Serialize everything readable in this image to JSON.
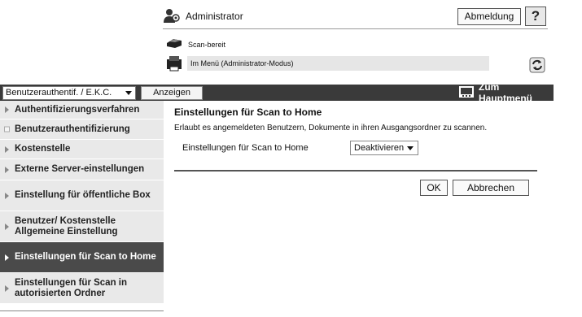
{
  "header": {
    "user_label": "Administrator",
    "logout_label": "Abmeldung",
    "help_label": "?",
    "status_ready": "Scan-bereit",
    "status_menu": "Im Menü (Administrator-Modus)"
  },
  "toolbar": {
    "mode_select_value": "Benutzerauthentif. / E.K.C.",
    "show_label": "Anzeigen",
    "home_label": "Zum Hauptmenü"
  },
  "sidebar": {
    "items": [
      {
        "label": "Authentifizierungsverfahren",
        "marker": "arrow",
        "active": false
      },
      {
        "label": "Benutzerauthentifizierung",
        "marker": "square",
        "active": false
      },
      {
        "label": "Kostenstelle",
        "marker": "arrow",
        "active": false
      },
      {
        "label": "Externe Server-einstellungen",
        "marker": "arrow",
        "active": false
      },
      {
        "label": "Einstellung für öffentliche Box",
        "marker": "arrow",
        "active": false
      },
      {
        "label": "Benutzer/ Kostenstelle Allgemeine Einstellung",
        "marker": "arrow",
        "active": false
      },
      {
        "label": "Einstellungen für Scan to Home",
        "marker": "arrow",
        "active": true
      },
      {
        "label": "Einstellungen für Scan in autorisierten Ordner",
        "marker": "arrow",
        "active": false
      }
    ]
  },
  "main": {
    "title": "Einstellungen für Scan to Home",
    "description": "Erlaubt es angemeldeten Benutzern, Dokumente in ihren Ausgangsordner zu scannen.",
    "field_label": "Einstellungen für Scan to Home",
    "field_value": "Deaktivieren",
    "ok_label": "OK",
    "cancel_label": "Abbrechen"
  },
  "colors": {
    "toolbar_bg": "#3a3a3a",
    "sidebar_bg": "#e9e9e9",
    "sidebar_active_bg": "#4a4a4a"
  },
  "icons": {
    "user": "administrator-icon",
    "printer_ready": "printer-icon",
    "printer_menu": "printer-menu-icon",
    "refresh": "refresh-icon",
    "home": "main-menu-icon"
  }
}
